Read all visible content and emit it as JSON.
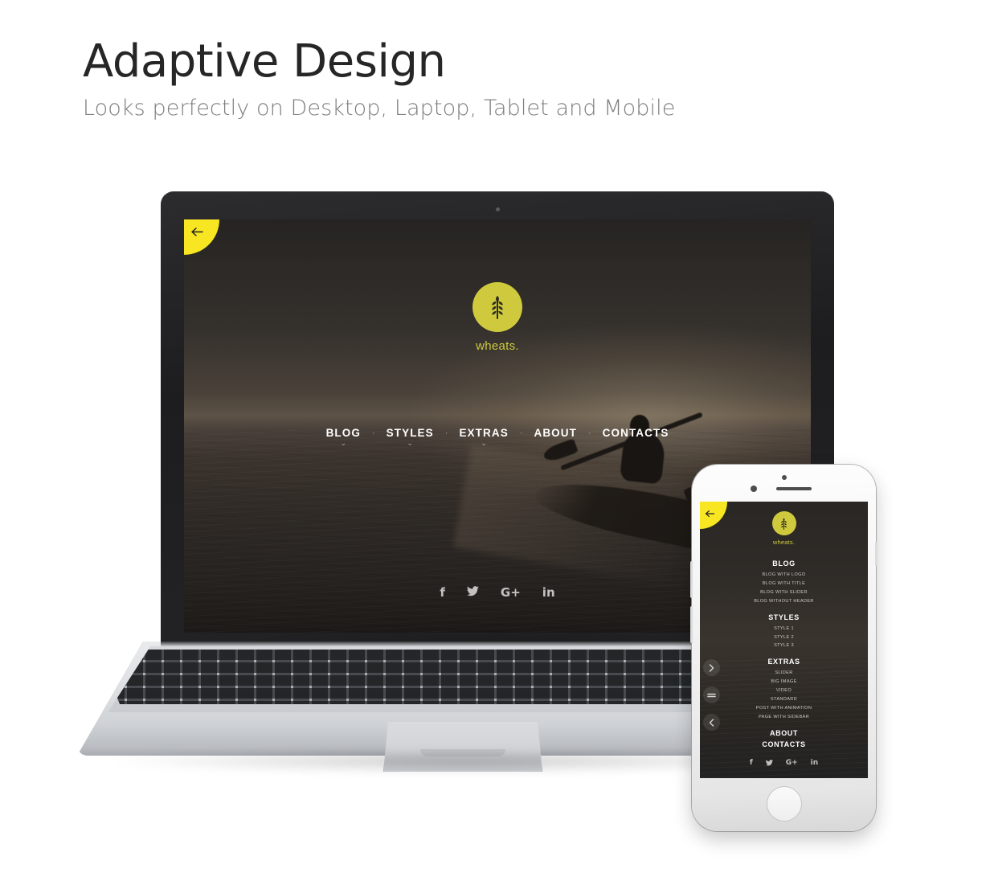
{
  "hero": {
    "title": "Adaptive Design",
    "subtitle": "Looks perfectly on Desktop, Laptop, Tablet and Mobile",
    "title_color": "#262626",
    "subtitle_color": "#7d7d7d"
  },
  "theme": {
    "accent_yellow": "#f7e621",
    "logo_yellow": "#cfca3d",
    "screen_dark": "#2a2724"
  },
  "laptop": {
    "corner_tab": {
      "icon": "arrow-left-icon",
      "glyph": "←"
    },
    "brand": {
      "mark_icon": "wheat-icon",
      "name": "wheats."
    },
    "nav": {
      "separator": "·",
      "caret": "⌄",
      "items": [
        {
          "label": "BLOG",
          "has_dropdown": true
        },
        {
          "label": "STYLES",
          "has_dropdown": true
        },
        {
          "label": "EXTRAS",
          "has_dropdown": true
        },
        {
          "label": "ABOUT",
          "has_dropdown": false
        },
        {
          "label": "CONTACTS",
          "has_dropdown": false
        }
      ]
    },
    "social": [
      {
        "name": "facebook-icon",
        "glyph": "f"
      },
      {
        "name": "twitter-icon",
        "glyph": "ᴠ"
      },
      {
        "name": "google-plus-icon",
        "glyph": "G+"
      },
      {
        "name": "linkedin-icon",
        "glyph": "in"
      }
    ]
  },
  "phone": {
    "corner_tab": {
      "icon": "arrow-left-icon",
      "glyph": "←"
    },
    "brand": {
      "mark_icon": "wheat-icon",
      "name": "wheats."
    },
    "controls": [
      {
        "name": "next-arrow-button",
        "glyph": "›"
      },
      {
        "name": "menu-toggle-button",
        "glyph": "≡"
      },
      {
        "name": "prev-arrow-button",
        "glyph": "‹"
      }
    ],
    "menu": [
      {
        "heading": "BLOG",
        "items": [
          "BLOG WITH LOGO",
          "BLOG WITH TITLE",
          "BLOG WITH SLIDER",
          "BLOG WITHOUT HEADER"
        ]
      },
      {
        "heading": "STYLES",
        "items": [
          "STYLE 1",
          "STYLE 2",
          "STYLE 3"
        ]
      },
      {
        "heading": "EXTRAS",
        "items": [
          "SLIDER",
          "BIG IMAGE",
          "VIDEO",
          "STANDARD",
          "POST WITH ANIMATION",
          "PAGE WITH SIDEBAR"
        ]
      },
      {
        "heading": "ABOUT",
        "items": []
      },
      {
        "heading": "CONTACTS",
        "items": []
      }
    ],
    "social": [
      {
        "name": "facebook-icon",
        "glyph": "f"
      },
      {
        "name": "twitter-icon",
        "glyph": "ᴠ"
      },
      {
        "name": "google-plus-icon",
        "glyph": "G+"
      },
      {
        "name": "linkedin-icon",
        "glyph": "in"
      }
    ]
  }
}
